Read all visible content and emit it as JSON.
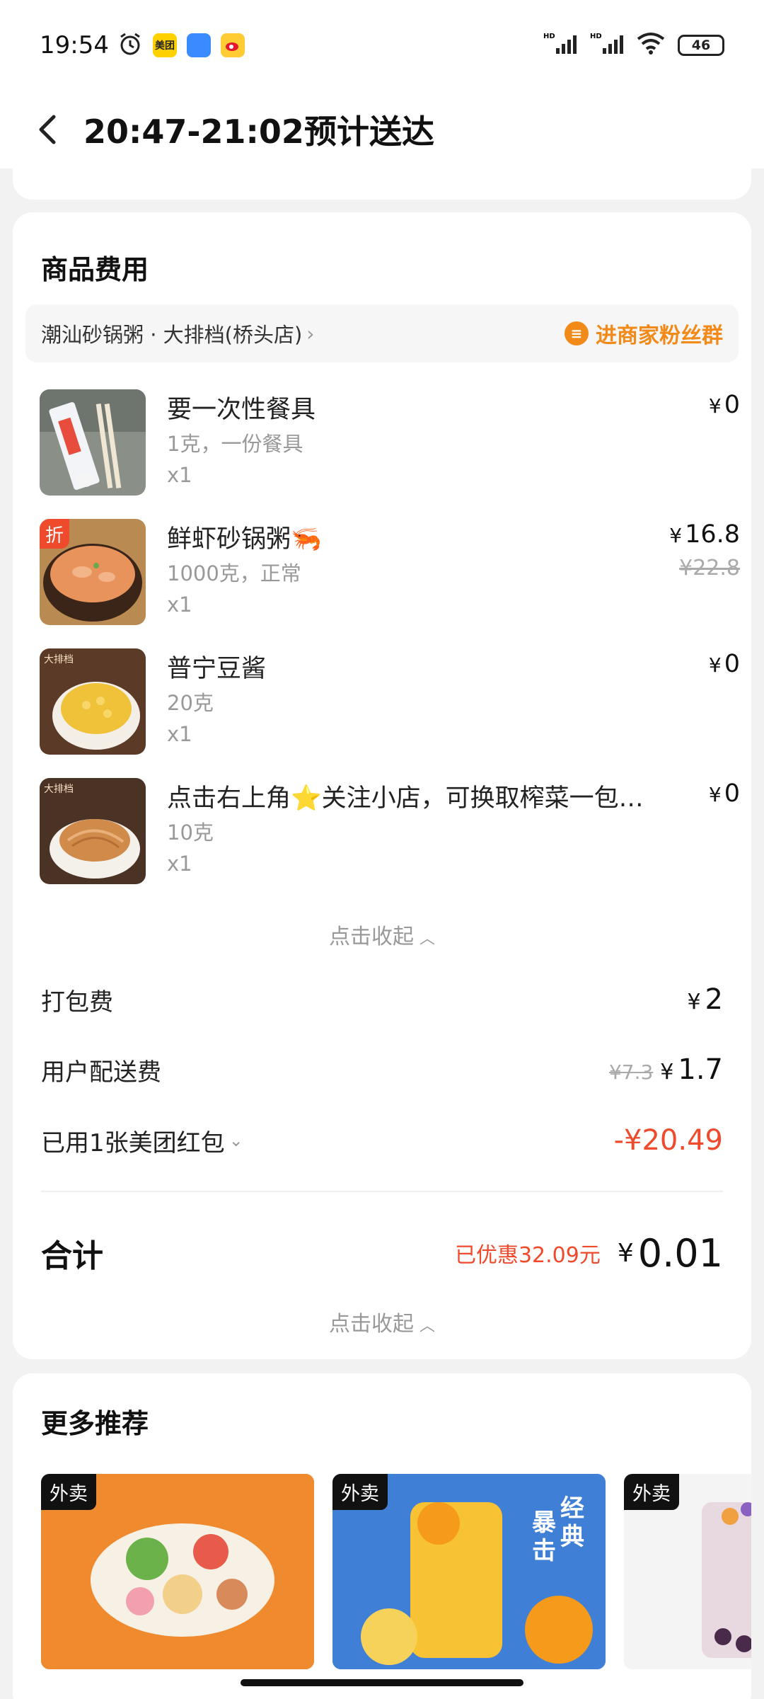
{
  "status_bar": {
    "time": "19:54",
    "network_label": "HD",
    "battery": "46"
  },
  "nav": {
    "title": "20:47-21:02预计送达"
  },
  "fees_section": {
    "title": "商品费用",
    "shop_name": "潮汕砂锅粥 · 大排档(桥头店)",
    "fans_group": "进商家粉丝群",
    "items": [
      {
        "name": "要一次性餐具",
        "spec": "1克，一份餐具",
        "qty": "x1",
        "price": "0",
        "original_price": ""
      },
      {
        "name": "鲜虾砂锅粥🦐",
        "spec": "1000克，正常",
        "qty": "x1",
        "price": "16.8",
        "original_price": "¥22.8",
        "tag": "折"
      },
      {
        "name": "普宁豆酱",
        "spec": "20克",
        "qty": "x1",
        "price": "0",
        "original_price": ""
      },
      {
        "name": "点击右上角⭐关注小店，可换取榨菜一包…",
        "spec": "10克",
        "qty": "x1",
        "price": "0",
        "original_price": ""
      }
    ],
    "collapse_label": "点击收起",
    "packing_fee_label": "打包费",
    "packing_fee": "2",
    "delivery_fee_label": "用户配送费",
    "delivery_fee_old": "¥7.3",
    "delivery_fee": "1.7",
    "coupon_label": "已用1张美团红包",
    "coupon_value": "-¥20.49",
    "total_label": "合计",
    "saved_label": "已优惠32.09元",
    "total": "0.01",
    "collapse_label_2": "点击收起"
  },
  "recommend": {
    "title": "更多推荐",
    "cards": [
      {
        "tag": "外卖"
      },
      {
        "tag": "外卖",
        "promo": "经典暴击"
      },
      {
        "tag": "外卖"
      }
    ]
  },
  "currency": "¥",
  "colors": {
    "accent_orange": "#f28a19",
    "discount_red": "#f04a2c"
  }
}
